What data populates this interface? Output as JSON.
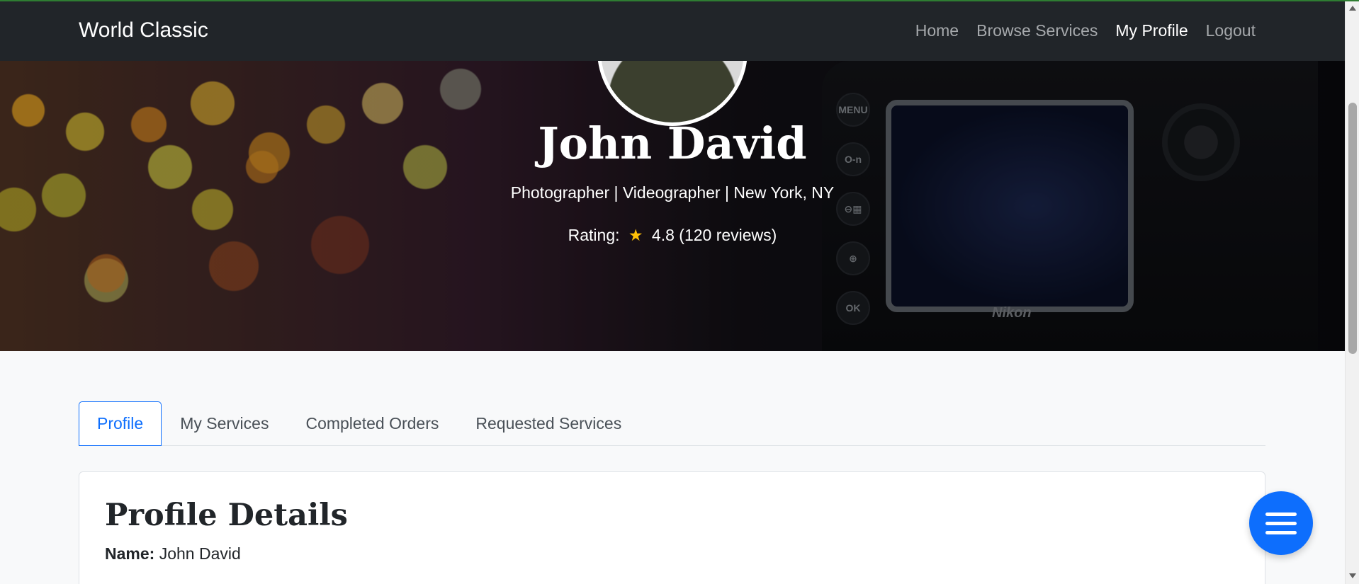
{
  "navbar": {
    "brand": "World Classic",
    "links": [
      {
        "label": "Home",
        "active": false
      },
      {
        "label": "Browse Services",
        "active": false
      },
      {
        "label": "My Profile",
        "active": true
      },
      {
        "label": "Logout",
        "active": false
      }
    ]
  },
  "hero": {
    "name": "John David",
    "subtitle": "Photographer | Videographer | New York, NY",
    "rating_label": "Rating:",
    "rating_icon": "star-icon",
    "rating_value": "4.8 (120 reviews)",
    "camera_brand": "Nikon",
    "camera_buttons": [
      "MENU",
      "O-n",
      "⊖▦",
      "⊕",
      "OK"
    ]
  },
  "tabs": [
    {
      "label": "Profile",
      "active": true
    },
    {
      "label": "My Services",
      "active": false
    },
    {
      "label": "Completed Orders",
      "active": false
    },
    {
      "label": "Requested Services",
      "active": false
    }
  ],
  "profile_card": {
    "title": "Profile Details",
    "name_label": "Name:",
    "name_value": "John David"
  },
  "fab": {
    "icon": "menu-icon"
  },
  "colors": {
    "primary": "#0d6efd",
    "navbar": "#212529",
    "star": "#ffc107"
  }
}
